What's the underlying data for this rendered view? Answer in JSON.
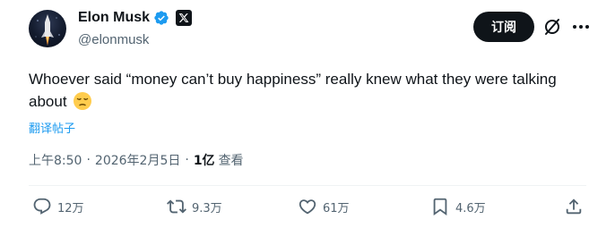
{
  "author": {
    "name": "Elon Musk",
    "handle": "@elonmusk"
  },
  "header": {
    "subscribe_label": "订阅"
  },
  "tweet": {
    "text": "Whoever said “money can’t buy happiness” really knew what they were talking about",
    "emoji": "pensive-face",
    "translate_label": "翻译帖子"
  },
  "meta": {
    "time": "上午8:50",
    "separator": "·",
    "date": "2026年2月5日",
    "views_count": "1亿",
    "views_label": "查看"
  },
  "actions": {
    "replies": "12万",
    "reposts": "9.3万",
    "likes": "61万",
    "bookmarks": "4.6万"
  },
  "colors": {
    "accent": "#1d9bf0",
    "muted": "#536471",
    "verified": "#1d9bf0"
  }
}
